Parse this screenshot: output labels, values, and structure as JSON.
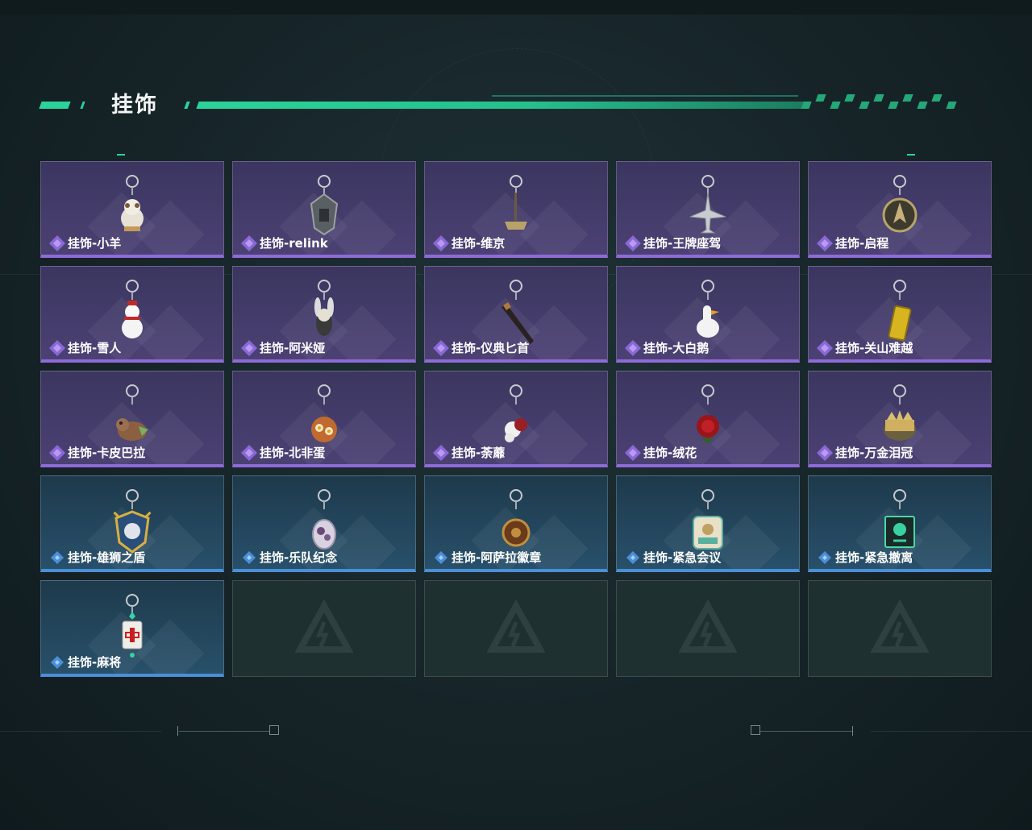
{
  "section": {
    "title": "挂饰"
  },
  "colors": {
    "accent": "#2ad39a",
    "purple_rarity": "#8f6ad9",
    "blue_rarity": "#4a8fd8"
  },
  "items": [
    {
      "label": "挂饰-小羊",
      "rarity": "purple",
      "icon": "lamb-charm-icon"
    },
    {
      "label": "挂饰-relink",
      "rarity": "purple",
      "icon": "relink-emblem-charm-icon"
    },
    {
      "label": "挂饰-维京",
      "rarity": "purple",
      "icon": "viking-hammer-charm-icon"
    },
    {
      "label": "挂饰-王牌座驾",
      "rarity": "purple",
      "icon": "jet-plane-charm-icon"
    },
    {
      "label": "挂饰-启程",
      "rarity": "purple",
      "icon": "compass-medal-charm-icon"
    },
    {
      "label": "挂饰-雪人",
      "rarity": "purple",
      "icon": "snowman-charm-icon"
    },
    {
      "label": "挂饰-阿米娅",
      "rarity": "purple",
      "icon": "bunny-figure-charm-icon"
    },
    {
      "label": "挂饰-仪典匕首",
      "rarity": "purple",
      "icon": "ceremonial-dagger-charm-icon"
    },
    {
      "label": "挂饰-大白鹅",
      "rarity": "purple",
      "icon": "white-goose-charm-icon"
    },
    {
      "label": "挂饰-关山难越",
      "rarity": "purple",
      "icon": "gold-bar-charm-icon"
    },
    {
      "label": "挂饰-卡皮巴拉",
      "rarity": "purple",
      "icon": "capybara-charm-icon"
    },
    {
      "label": "挂饰-北非蛋",
      "rarity": "purple",
      "icon": "shakshuka-charm-icon"
    },
    {
      "label": "挂饰-荼蘼",
      "rarity": "purple",
      "icon": "flower-figure-charm-icon"
    },
    {
      "label": "挂饰-绒花",
      "rarity": "purple",
      "icon": "red-rose-charm-icon"
    },
    {
      "label": "挂饰-万金泪冠",
      "rarity": "purple",
      "icon": "golden-crown-charm-icon"
    },
    {
      "label": "挂饰-雄狮之盾",
      "rarity": "blue",
      "icon": "lion-shield-charm-icon"
    },
    {
      "label": "挂饰-乐队纪念",
      "rarity": "blue",
      "icon": "band-badge-charm-icon"
    },
    {
      "label": "挂饰-阿萨拉徽章",
      "rarity": "blue",
      "icon": "asala-badge-charm-icon"
    },
    {
      "label": "挂饰-紧急会议",
      "rarity": "blue",
      "icon": "emergency-meeting-charm-icon"
    },
    {
      "label": "挂饰-紧急撤离",
      "rarity": "blue",
      "icon": "emergency-exit-charm-icon"
    },
    {
      "label": "挂饰-麻将",
      "rarity": "blue",
      "icon": "mahjong-tile-charm-icon"
    },
    {
      "label": "",
      "rarity": "empty",
      "icon": "empty-slot-logo-icon"
    },
    {
      "label": "",
      "rarity": "empty",
      "icon": "empty-slot-logo-icon"
    },
    {
      "label": "",
      "rarity": "empty",
      "icon": "empty-slot-logo-icon"
    },
    {
      "label": "",
      "rarity": "empty",
      "icon": "empty-slot-logo-icon"
    }
  ]
}
